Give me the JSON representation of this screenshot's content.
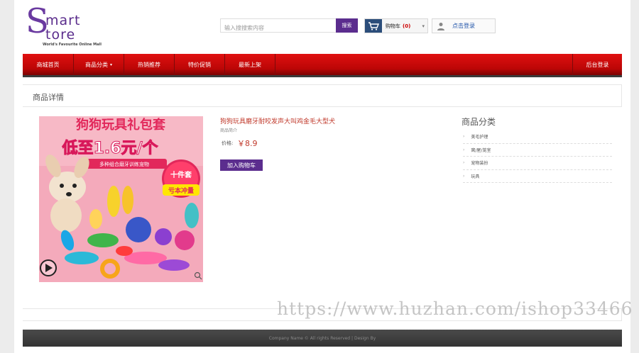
{
  "header": {
    "logo_big": "S",
    "logo_line1": "mart",
    "logo_line2": "tore",
    "tagline": "World's Favourite Online Mall",
    "search_placeholder": "输入搜搜索内容",
    "search_button": "搜索",
    "cart_label": "购物车",
    "cart_count": "(0)",
    "login_label": "点击登录"
  },
  "nav": {
    "items": [
      {
        "label": "商城首页"
      },
      {
        "label": "商品分类",
        "has_caret": true
      },
      {
        "label": "热销推荐"
      },
      {
        "label": "特价促销"
      },
      {
        "label": "最新上架"
      }
    ],
    "admin": "后台登录"
  },
  "section": {
    "title": "商品详情"
  },
  "product": {
    "image_text_1": "狗狗玩具礼包套",
    "image_text_2": "低至1.6元/个",
    "image_text_3": "多种组合磨牙训练宠物",
    "image_badge_1": "十件套",
    "image_badge_2": "亏本冲量",
    "title": "狗狗玩具磨牙耐咬发声大叫鸡金毛大型犬",
    "subtitle": "商品简介",
    "price_label": "价格:",
    "price": "￥8.9",
    "add_to_cart": "加入购物车"
  },
  "categories": {
    "title": "商品分类",
    "items": [
      {
        "label": "美毛护理"
      },
      {
        "label": "窝/屋/笼室"
      },
      {
        "label": "宠物装扮"
      },
      {
        "label": "玩具"
      }
    ]
  },
  "footer": {
    "text": "Company Name © All rights Reserved | Design By"
  },
  "watermark": "https://www.huzhan.com/ishop33466",
  "colors": {
    "brand_purple": "#5b2d8e",
    "nav_red": "#d10a0a",
    "price_red": "#c0392b"
  }
}
